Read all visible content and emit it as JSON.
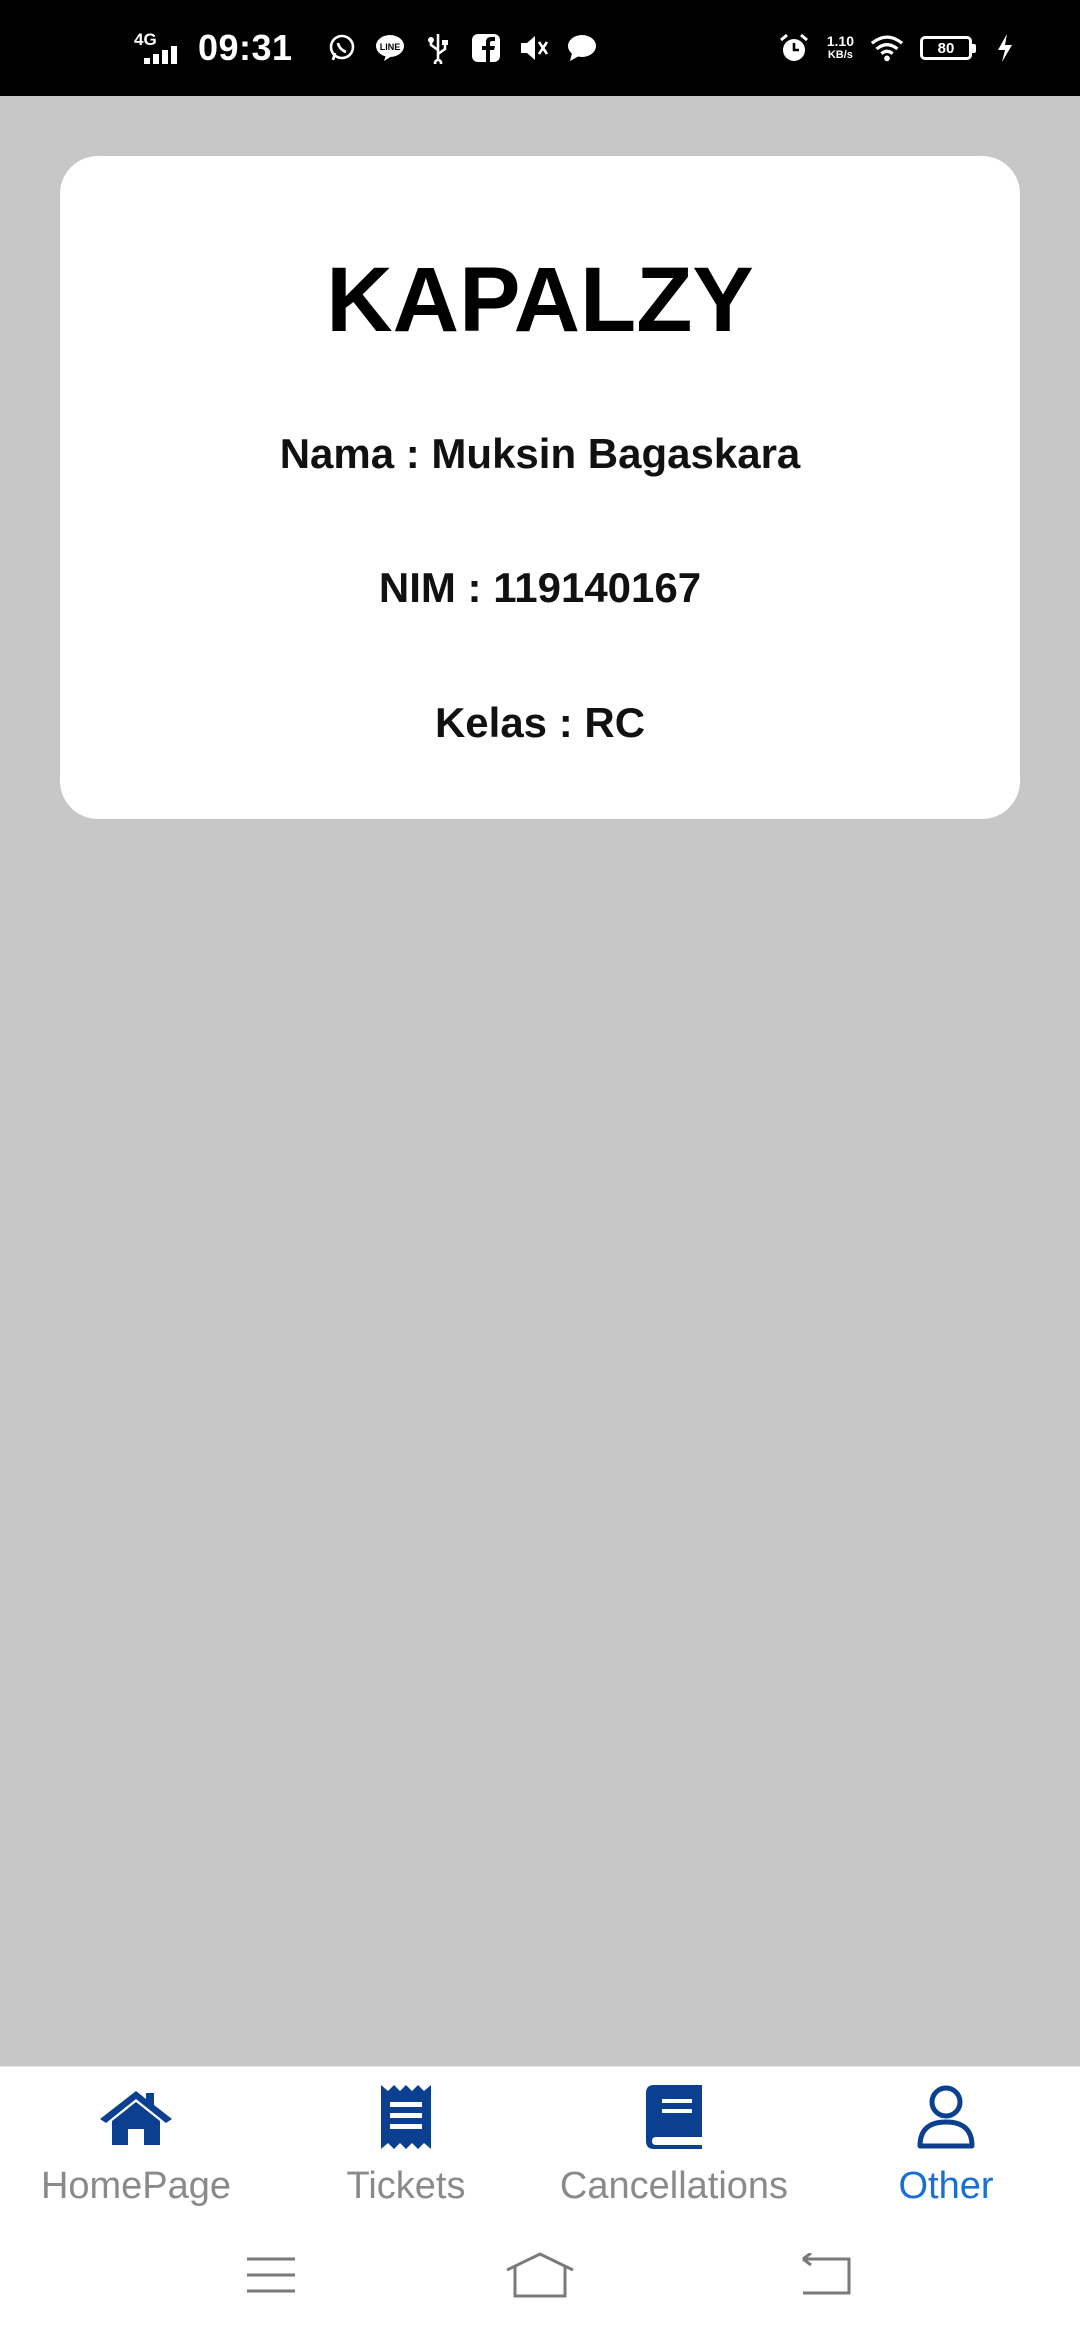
{
  "status_bar": {
    "network": "4G",
    "time": "09:31",
    "speed_value": "1.10",
    "speed_unit": "KB/s",
    "battery": "80",
    "icons": [
      "whatsapp-icon",
      "line-icon",
      "usb-icon",
      "facebook-icon",
      "mute-icon",
      "chat-bubble-icon",
      "alarm-icon",
      "wifi-icon",
      "battery-icon",
      "charging-icon"
    ]
  },
  "card": {
    "title": "KAPALZY",
    "nama": "Nama : Muksin Bagaskara",
    "nim": "NIM : 119140167",
    "kelas": "Kelas : RC"
  },
  "bottom_nav": {
    "items": [
      {
        "label": "HomePage",
        "icon": "home-icon",
        "active": false
      },
      {
        "label": "Tickets",
        "icon": "receipt-icon",
        "active": false
      },
      {
        "label": "Cancellations",
        "icon": "book-icon",
        "active": false
      },
      {
        "label": "Other",
        "icon": "user-icon",
        "active": true
      }
    ]
  },
  "colors": {
    "background": "#c8c7c8",
    "nav_icon": "#0b3f8f",
    "active_label": "#1a6fd6",
    "inactive_label": "#8a8a8a"
  },
  "system_nav": [
    "menu-icon",
    "home-outline-icon",
    "back-icon"
  ]
}
